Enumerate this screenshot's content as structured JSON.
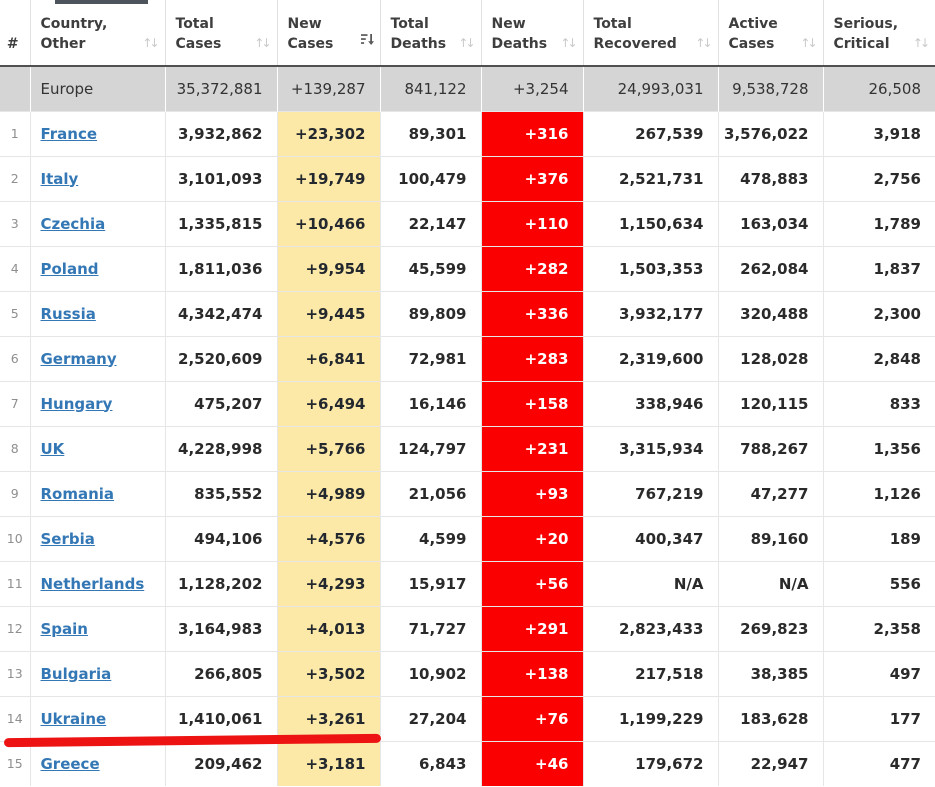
{
  "columns": [
    {
      "id": "rank",
      "line1": "#",
      "line2": "",
      "sort": "none"
    },
    {
      "id": "country",
      "line1": "Country,",
      "line2": "Other",
      "sort": "inactive"
    },
    {
      "id": "total_cases",
      "line1": "Total",
      "line2": "Cases",
      "sort": "inactive"
    },
    {
      "id": "new_cases",
      "line1": "New",
      "line2": "Cases",
      "sort": "active-desc"
    },
    {
      "id": "total_deaths",
      "line1": "Total",
      "line2": "Deaths",
      "sort": "inactive"
    },
    {
      "id": "new_deaths",
      "line1": "New",
      "line2": "Deaths",
      "sort": "inactive"
    },
    {
      "id": "total_recovered",
      "line1": "Total",
      "line2": "Recovered",
      "sort": "inactive"
    },
    {
      "id": "active_cases",
      "line1": "Active",
      "line2": "Cases",
      "sort": "inactive"
    },
    {
      "id": "serious_critical",
      "line1": "Serious,",
      "line2": "Critical",
      "sort": "inactive"
    }
  ],
  "continent_row": {
    "rank": "",
    "name": "Europe",
    "total_cases": "35,372,881",
    "new_cases": "+139,287",
    "total_deaths": "841,122",
    "new_deaths": "+3,254",
    "total_recovered": "24,993,031",
    "active_cases": "9,538,728",
    "serious_critical": "26,508"
  },
  "countries": [
    {
      "rank": "1",
      "name": "France",
      "total_cases": "3,932,862",
      "new_cases": "+23,302",
      "total_deaths": "89,301",
      "new_deaths": "+316",
      "total_recovered": "267,539",
      "active_cases": "3,576,022",
      "serious_critical": "3,918"
    },
    {
      "rank": "2",
      "name": "Italy",
      "total_cases": "3,101,093",
      "new_cases": "+19,749",
      "total_deaths": "100,479",
      "new_deaths": "+376",
      "total_recovered": "2,521,731",
      "active_cases": "478,883",
      "serious_critical": "2,756"
    },
    {
      "rank": "3",
      "name": "Czechia",
      "total_cases": "1,335,815",
      "new_cases": "+10,466",
      "total_deaths": "22,147",
      "new_deaths": "+110",
      "total_recovered": "1,150,634",
      "active_cases": "163,034",
      "serious_critical": "1,789"
    },
    {
      "rank": "4",
      "name": "Poland",
      "total_cases": "1,811,036",
      "new_cases": "+9,954",
      "total_deaths": "45,599",
      "new_deaths": "+282",
      "total_recovered": "1,503,353",
      "active_cases": "262,084",
      "serious_critical": "1,837"
    },
    {
      "rank": "5",
      "name": "Russia",
      "total_cases": "4,342,474",
      "new_cases": "+9,445",
      "total_deaths": "89,809",
      "new_deaths": "+336",
      "total_recovered": "3,932,177",
      "active_cases": "320,488",
      "serious_critical": "2,300"
    },
    {
      "rank": "6",
      "name": "Germany",
      "total_cases": "2,520,609",
      "new_cases": "+6,841",
      "total_deaths": "72,981",
      "new_deaths": "+283",
      "total_recovered": "2,319,600",
      "active_cases": "128,028",
      "serious_critical": "2,848"
    },
    {
      "rank": "7",
      "name": "Hungary",
      "total_cases": "475,207",
      "new_cases": "+6,494",
      "total_deaths": "16,146",
      "new_deaths": "+158",
      "total_recovered": "338,946",
      "active_cases": "120,115",
      "serious_critical": "833"
    },
    {
      "rank": "8",
      "name": "UK",
      "total_cases": "4,228,998",
      "new_cases": "+5,766",
      "total_deaths": "124,797",
      "new_deaths": "+231",
      "total_recovered": "3,315,934",
      "active_cases": "788,267",
      "serious_critical": "1,356"
    },
    {
      "rank": "9",
      "name": "Romania",
      "total_cases": "835,552",
      "new_cases": "+4,989",
      "total_deaths": "21,056",
      "new_deaths": "+93",
      "total_recovered": "767,219",
      "active_cases": "47,277",
      "serious_critical": "1,126"
    },
    {
      "rank": "10",
      "name": "Serbia",
      "total_cases": "494,106",
      "new_cases": "+4,576",
      "total_deaths": "4,599",
      "new_deaths": "+20",
      "total_recovered": "400,347",
      "active_cases": "89,160",
      "serious_critical": "189"
    },
    {
      "rank": "11",
      "name": "Netherlands",
      "total_cases": "1,128,202",
      "new_cases": "+4,293",
      "total_deaths": "15,917",
      "new_deaths": "+56",
      "total_recovered": "N/A",
      "active_cases": "N/A",
      "serious_critical": "556"
    },
    {
      "rank": "12",
      "name": "Spain",
      "total_cases": "3,164,983",
      "new_cases": "+4,013",
      "total_deaths": "71,727",
      "new_deaths": "+291",
      "total_recovered": "2,823,433",
      "active_cases": "269,823",
      "serious_critical": "2,358"
    },
    {
      "rank": "13",
      "name": "Bulgaria",
      "total_cases": "266,805",
      "new_cases": "+3,502",
      "total_deaths": "10,902",
      "new_deaths": "+138",
      "total_recovered": "217,518",
      "active_cases": "38,385",
      "serious_critical": "497"
    },
    {
      "rank": "14",
      "name": "Ukraine",
      "total_cases": "1,410,061",
      "new_cases": "+3,261",
      "total_deaths": "27,204",
      "new_deaths": "+76",
      "total_recovered": "1,199,229",
      "active_cases": "183,628",
      "serious_critical": "177"
    },
    {
      "rank": "15",
      "name": "Greece",
      "total_cases": "209,462",
      "new_cases": "+3,181",
      "total_deaths": "6,843",
      "new_deaths": "+46",
      "total_recovered": "179,672",
      "active_cases": "22,947",
      "serious_critical": "477"
    }
  ],
  "annotation": {
    "type": "red-underline",
    "target_row": "Ukraine"
  },
  "colors": {
    "new_cases_bg": "#fce9a8",
    "new_deaths_bg": "#fb0000",
    "continent_row_bg": "#d5d5d5",
    "country_link": "#3377b5",
    "annotation_red": "#ec1312",
    "top_partial_bar": "#4d545c"
  }
}
